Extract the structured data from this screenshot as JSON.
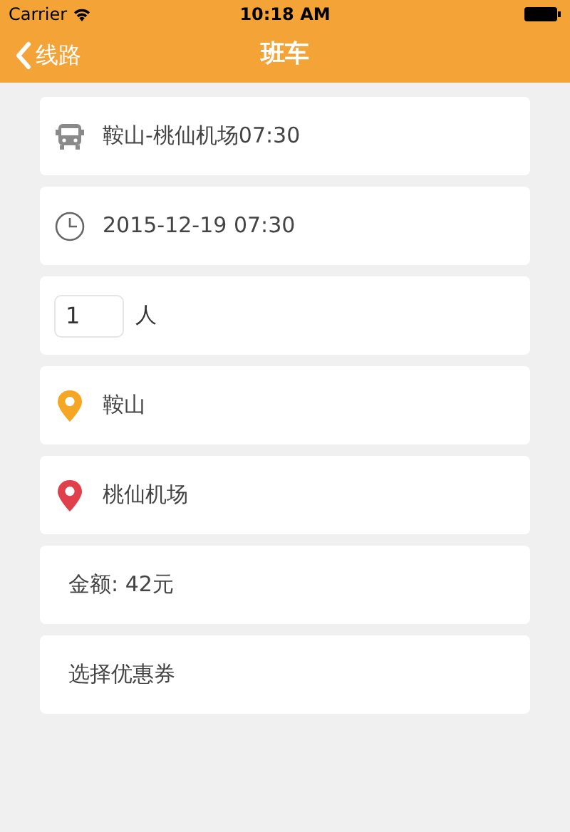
{
  "status_bar": {
    "carrier": "Carrier",
    "time": "10:18 AM"
  },
  "nav": {
    "back": "线路",
    "title": "班车"
  },
  "rows": [
    {
      "kind": "bus",
      "text": "鞍山-桃仙机场07:30"
    },
    {
      "kind": "clock",
      "text": "2015-12-19 07:30"
    },
    {
      "kind": "count",
      "value": "1",
      "unit": "人"
    },
    {
      "kind": "pin",
      "color": "#f5a623",
      "text": "鞍山"
    },
    {
      "kind": "pin",
      "color": "#e0404a",
      "text": "桃仙机场"
    },
    {
      "kind": "text",
      "text": "金额: 42元"
    },
    {
      "kind": "text",
      "text": "选择优惠券"
    }
  ]
}
